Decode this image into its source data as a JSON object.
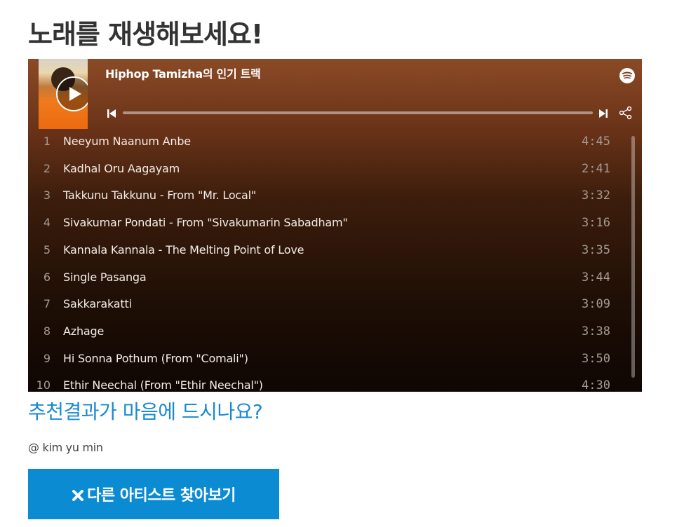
{
  "page": {
    "title": "노래를 재생해보세요!",
    "question": "추천결과가 마음에 드시나요?",
    "author": "@ kim yu min",
    "find_button_label": "다른 아티스트 찾아보기"
  },
  "player": {
    "heading": "Hiphop Tamizha의 인기 트랙",
    "background_color": "#8b4a26",
    "progress": 0.0,
    "tracks": [
      {
        "num": "1",
        "name": "Neeyum Naanum Anbe",
        "duration": "4:45"
      },
      {
        "num": "2",
        "name": "Kadhal Oru Aagayam",
        "duration": "2:41"
      },
      {
        "num": "3",
        "name": "Takkunu Takkunu - From \"Mr. Local\"",
        "duration": "3:32"
      },
      {
        "num": "4",
        "name": "Sivakumar Pondati - From \"Sivakumarin Sabadham\"",
        "duration": "3:16"
      },
      {
        "num": "5",
        "name": "Kannala Kannala - The Melting Point of Love",
        "duration": "3:35"
      },
      {
        "num": "6",
        "name": "Single Pasanga",
        "duration": "3:44"
      },
      {
        "num": "7",
        "name": "Sakkarakatti",
        "duration": "3:09"
      },
      {
        "num": "8",
        "name": "Azhage",
        "duration": "3:38"
      },
      {
        "num": "9",
        "name": "Hi Sonna Pothum (From \"Comali\")",
        "duration": "3:50"
      },
      {
        "num": "10",
        "name": "Ethir Neechal (From \"Ethir Neechal\")",
        "duration": "4:30"
      }
    ]
  },
  "icons": {
    "play": "play-icon",
    "spotify": "spotify-logo-icon",
    "previous": "skip-previous-icon",
    "next": "skip-next-icon",
    "share": "share-icon",
    "close": "x-icon"
  },
  "colors": {
    "title": "#333333",
    "question": "#1a8ad0",
    "button": "#0b8bd2"
  }
}
